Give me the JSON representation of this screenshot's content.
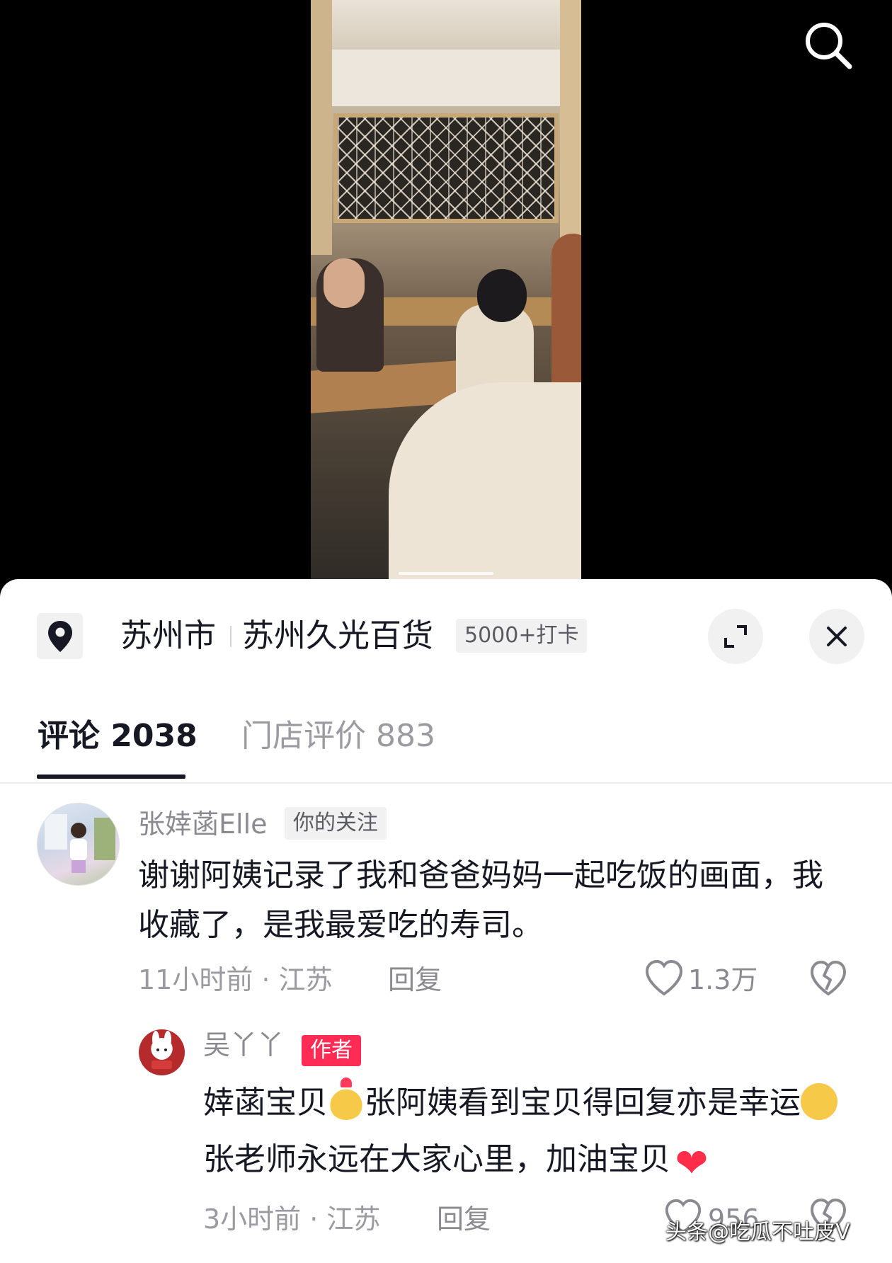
{
  "video": {
    "description_alt": ""
  },
  "location": {
    "city": "苏州市",
    "store": "苏州久光百货",
    "checkin_badge": "5000+打卡"
  },
  "tabs": [
    {
      "label": "评论 2038",
      "active": true
    },
    {
      "label": "门店评价 883",
      "active": false
    }
  ],
  "comments": [
    {
      "username": "张婞菡Elle",
      "tag": "你的关注",
      "text": "谢谢阿姨记录了我和爸爸妈妈一起吃饭的画面，我收藏了，是我最爱吃的寿司。",
      "time_location": "11小时前 · 江苏",
      "reply_label": "回复",
      "like_count": "1.3万"
    },
    {
      "username": "吴丫丫",
      "tag": "作者",
      "text_part1": "婞菡宝贝",
      "text_part2": "张阿姨看到宝贝得回复亦是幸运",
      "text_part3": "张老师永远在大家心里，加油宝贝",
      "time_location": "3小时前 · 江苏",
      "reply_label": "回复",
      "like_count": "956"
    }
  ],
  "watermark": "头条@吃瓜不吐皮V",
  "colors": {
    "author_tag": "#fe2c55",
    "text_primary": "#161823",
    "text_secondary": "#9a9aa0",
    "chip_bg": "#f1f1f2"
  },
  "icons": [
    "search-icon",
    "location-pin-icon",
    "expand-icon",
    "close-icon",
    "heart-icon",
    "broken-heart-icon"
  ]
}
